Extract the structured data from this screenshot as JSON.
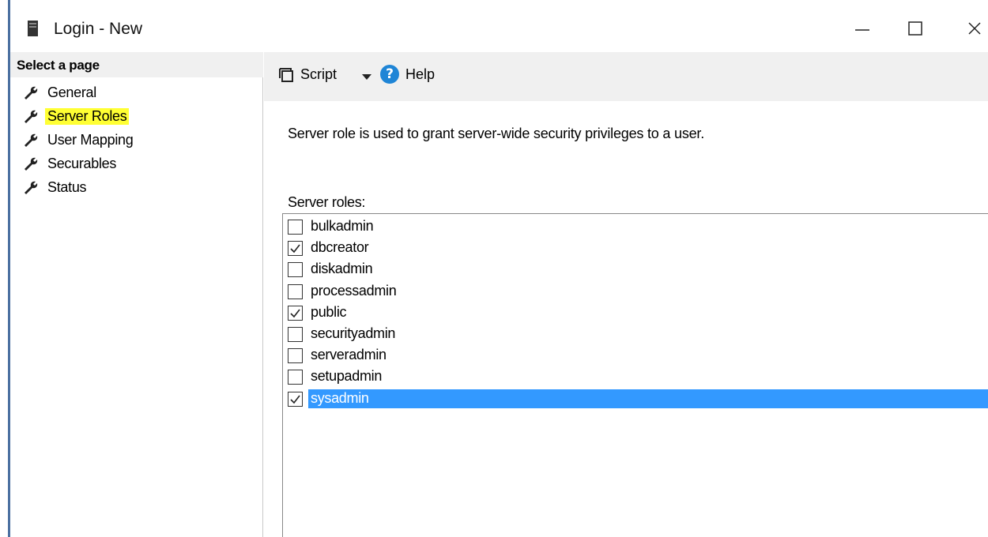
{
  "window": {
    "title": "Login - New",
    "minimize_glyph": "—",
    "close_glyph": "✕"
  },
  "left_panel": {
    "header": "Select a page",
    "items": [
      {
        "label": "General",
        "active": false
      },
      {
        "label": "Server Roles",
        "active": true
      },
      {
        "label": "User Mapping",
        "active": false
      },
      {
        "label": "Securables",
        "active": false
      },
      {
        "label": "Status",
        "active": false
      }
    ]
  },
  "toolbar": {
    "script_label": "Script",
    "help_label": "Help",
    "help_glyph": "?"
  },
  "main": {
    "description": "Server role is used to grant server-wide security privileges to a user.",
    "roles_label": "Server roles:",
    "roles": [
      {
        "name": "bulkadmin",
        "checked": false
      },
      {
        "name": "dbcreator",
        "checked": true
      },
      {
        "name": "diskadmin",
        "checked": false
      },
      {
        "name": "processadmin",
        "checked": false
      },
      {
        "name": "public",
        "checked": true
      },
      {
        "name": "securityadmin",
        "checked": false
      },
      {
        "name": "serveradmin",
        "checked": false
      },
      {
        "name": "setupadmin",
        "checked": false
      },
      {
        "name": "sysadmin",
        "checked": true,
        "selected": true
      }
    ]
  },
  "colors": {
    "highlight_yellow": "#ffff33",
    "selection_blue": "#3399ff",
    "help_blue": "#1f85d6"
  }
}
